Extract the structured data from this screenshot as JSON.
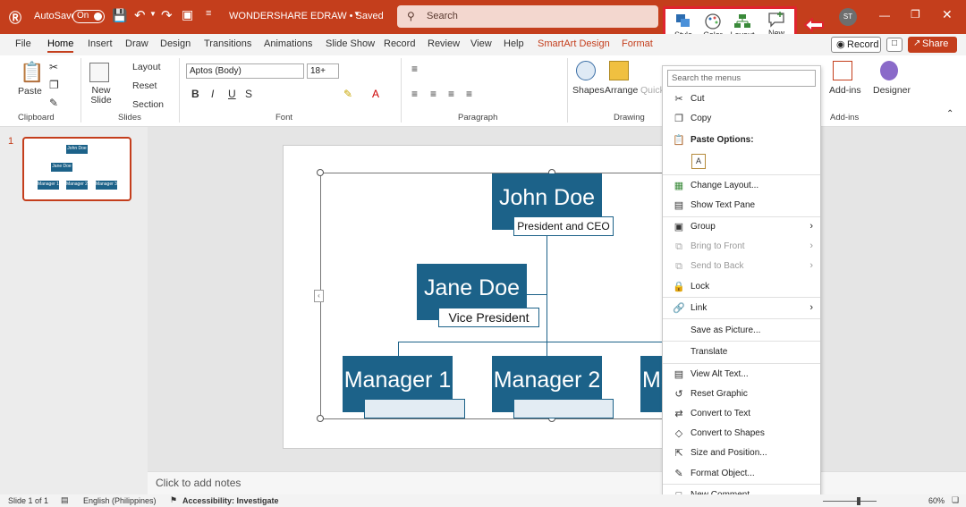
{
  "titlebar": {
    "autosave_label": "AutoSave",
    "autosave_state": "On",
    "doc_title": "WONDERSHARE EDRAW • Saved",
    "search_placeholder": "Search",
    "quick_buttons": [
      {
        "label": "Style",
        "icon": "style-icon"
      },
      {
        "label": "Color",
        "icon": "color-palette-icon"
      },
      {
        "label": "Layout",
        "icon": "layout-icon"
      },
      {
        "label": "New Comment",
        "icon": "new-comment-icon"
      }
    ],
    "user_initials": "ST",
    "accent_color": "#c43e1c",
    "highlight_color": "#e0242e"
  },
  "tabs": {
    "items": [
      "File",
      "Home",
      "Insert",
      "Draw",
      "Design",
      "Transitions",
      "Animations",
      "Slide Show",
      "Record",
      "Review",
      "View",
      "Help"
    ],
    "contextual": [
      "SmartArt Design",
      "Format"
    ],
    "active": "Home",
    "record_label": "Record",
    "share_label": "Share"
  },
  "ribbon": {
    "clipboard": {
      "paste": "Paste",
      "group": "Clipboard"
    },
    "slides": {
      "new_slide": "New Slide",
      "layout": "Layout",
      "reset": "Reset",
      "section": "Section",
      "group": "Slides"
    },
    "font": {
      "family": "Aptos (Body)",
      "size": "18+",
      "group": "Font"
    },
    "paragraph": {
      "group": "Paragraph"
    },
    "drawing": {
      "shapes": "Shapes",
      "arrange": "Arrange",
      "quick_styles": "Quick Styles",
      "group": "Drawing"
    },
    "addins": {
      "addins": "Add-ins",
      "designer": "Designer",
      "group": "Add-ins"
    }
  },
  "thumbnails": {
    "slide_number": "1",
    "mini_labels": [
      "John Doe",
      "Jane Doe",
      "Manager 1",
      "Manager 2",
      "Manager 3"
    ]
  },
  "slide": {
    "ceo_name": "John Doe",
    "ceo_title": "President and CEO",
    "vp_name": "Jane Doe",
    "vp_title": "Vice President",
    "managers": [
      "Manager 1",
      "Manager 2",
      "Ma"
    ],
    "node_color": "#1c6289"
  },
  "notes": {
    "placeholder": "Click to add notes"
  },
  "context_menu": {
    "search_placeholder": "Search the menus",
    "paste_options_label": "Paste Options:",
    "items": [
      {
        "label": "Cut",
        "icon": "scissors-icon",
        "enabled": true
      },
      {
        "label": "Copy",
        "icon": "copy-icon",
        "enabled": true
      },
      {
        "label": "Change Layout...",
        "icon": "change-layout-icon",
        "enabled": true
      },
      {
        "label": "Show Text Pane",
        "icon": "text-pane-icon",
        "enabled": true
      },
      {
        "label": "Group",
        "icon": "group-icon",
        "enabled": true
      },
      {
        "label": "Bring to Front",
        "icon": "bring-front-icon",
        "enabled": false
      },
      {
        "label": "Send to Back",
        "icon": "send-back-icon",
        "enabled": false
      },
      {
        "label": "Lock",
        "icon": "lock-icon",
        "enabled": true
      },
      {
        "label": "Link",
        "icon": "link-icon",
        "enabled": true
      },
      {
        "label": "Save as Picture...",
        "icon": "",
        "enabled": true
      },
      {
        "label": "Translate",
        "icon": "translate-icon",
        "enabled": true
      },
      {
        "label": "View Alt Text...",
        "icon": "alt-text-icon",
        "enabled": true
      },
      {
        "label": "Reset Graphic",
        "icon": "reset-graphic-icon",
        "enabled": true
      },
      {
        "label": "Convert to Text",
        "icon": "convert-text-icon",
        "enabled": true
      },
      {
        "label": "Convert to Shapes",
        "icon": "convert-shapes-icon",
        "enabled": true
      },
      {
        "label": "Size and Position...",
        "icon": "size-position-icon",
        "enabled": true
      },
      {
        "label": "Format Object...",
        "icon": "format-object-icon",
        "enabled": true
      },
      {
        "label": "New Comment",
        "icon": "comment-icon",
        "enabled": true
      }
    ]
  },
  "statusbar": {
    "slide_info": "Slide 1 of 1",
    "language": "English (Philippines)",
    "accessibility": "Accessibility: Investigate",
    "zoom": "60%"
  }
}
